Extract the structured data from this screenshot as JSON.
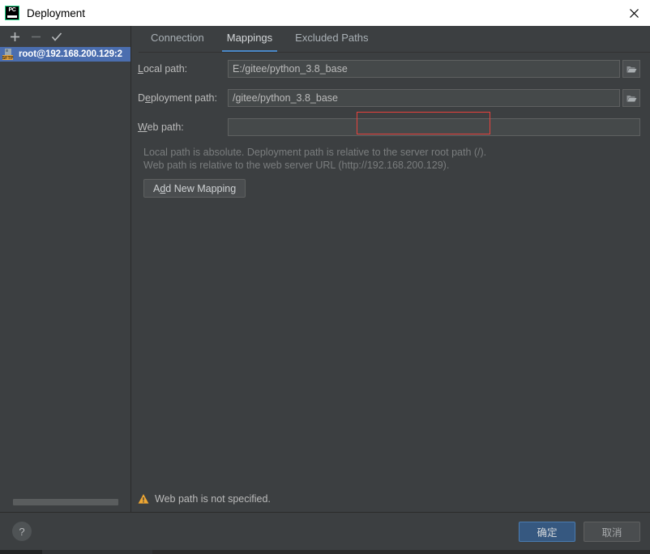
{
  "window": {
    "title": "Deployment",
    "logo_icon": "pycharm-logo-icon",
    "logo_text": "PC",
    "close_icon": "close-icon"
  },
  "sidebar": {
    "toolbar": [
      {
        "name": "add-server-button",
        "icon": "plus-icon",
        "glyph": "+",
        "enabled": true
      },
      {
        "name": "remove-server-button",
        "icon": "minus-icon",
        "glyph": "−",
        "enabled": false
      },
      {
        "name": "set-default-server-button",
        "icon": "check-icon",
        "glyph": "✓",
        "enabled": true
      }
    ],
    "items": [
      {
        "label": "root@192.168.200.129:2",
        "icon": "sftp-server-icon",
        "badge": "SFTP",
        "selected": true
      }
    ],
    "scrollbar": "horizontal-scrollbar"
  },
  "main": {
    "tabs": [
      {
        "label": "Connection",
        "active": false
      },
      {
        "label": "Mappings",
        "active": true
      },
      {
        "label": "Excluded Paths",
        "active": false
      }
    ],
    "form": {
      "rows": [
        {
          "label_pre": "",
          "label_mnemonic": "L",
          "label_post": "ocal path:",
          "value": "E:/gitee/python_3.8_base",
          "placeholder": "",
          "name": "local-path-field",
          "has_browse": true,
          "width": "narrow"
        },
        {
          "label_pre": "D",
          "label_mnemonic": "e",
          "label_post": "ployment path:",
          "value": "/gitee/python_3.8_base",
          "placeholder": "",
          "name": "deployment-path-field",
          "has_browse": true,
          "width": "narrow"
        },
        {
          "label_pre": "",
          "label_mnemonic": "W",
          "label_post": "eb path:",
          "value": "",
          "placeholder": "",
          "name": "web-path-field",
          "has_browse": false,
          "width": "wide"
        }
      ],
      "browse_icon": "folder-open-icon",
      "hint_line1": "Local path is absolute. Deployment path is relative to the server root path (/).",
      "hint_line2": "Web path is relative to the web server URL (http://192.168.200.129).",
      "add_button": {
        "pre": "A",
        "mnemonic": "d",
        "post": "d New Mapping"
      }
    },
    "warning": {
      "icon": "warning-triangle-icon",
      "text": "Web path is not specified."
    },
    "annotation": {
      "name": "red-highlight-box",
      "color": "#e8413c"
    }
  },
  "footer": {
    "help_label": "?",
    "help_icon": "help-circle-icon",
    "ok_label": "确定",
    "cancel_label": "取消"
  },
  "colors": {
    "background": "#3c3f41",
    "field_bg": "#45494a",
    "selection": "#4b6eaf",
    "accent_tab": "#4a88c7",
    "ok_button": "#365880",
    "warning": "#f0a732",
    "annotation": "#e8413c",
    "logo_green": "#21d789"
  }
}
